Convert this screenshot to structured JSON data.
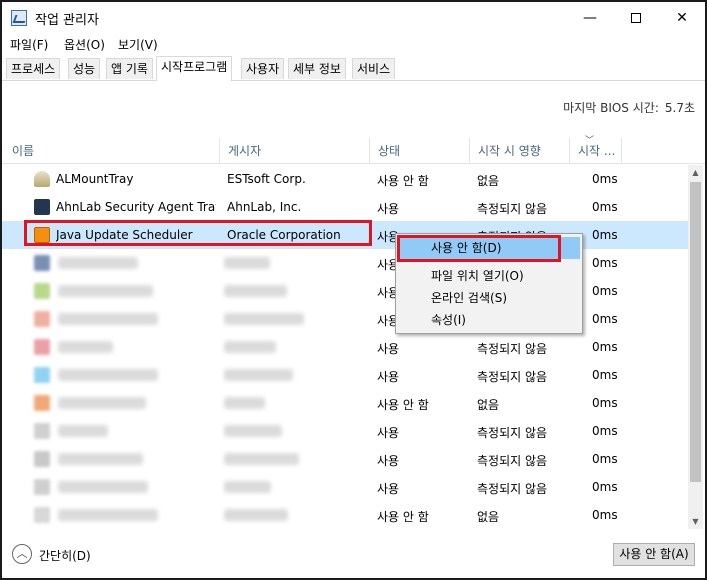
{
  "window": {
    "title": "작업 관리자",
    "minimize": "—",
    "close": "✕"
  },
  "menu": [
    {
      "label": "파일(F)"
    },
    {
      "label": "옵션(O)"
    },
    {
      "label": "보기(V)"
    }
  ],
  "tabs": [
    {
      "label": "프로세스"
    },
    {
      "label": "성능"
    },
    {
      "label": "앱 기록"
    },
    {
      "label": "시작프로그램",
      "active": true
    },
    {
      "label": "사용자"
    },
    {
      "label": "세부 정보"
    },
    {
      "label": "서비스"
    }
  ],
  "bios": {
    "label": "마지막 BIOS 시간:",
    "value": "5.7초"
  },
  "columns": {
    "name": "이름",
    "publisher": "게시자",
    "status": "상태",
    "impact": "시작 시 영향",
    "cpu": "시작 ..."
  },
  "rows": [
    {
      "name": "ALMountTray",
      "publisher": "ESTsoft Corp.",
      "status": "사용 안 함",
      "impact": "없음",
      "time": "0ms",
      "icon": "almount-icon"
    },
    {
      "name": "AhnLab Security Agent Tray...",
      "publisher": "AhnLab, Inc.",
      "status": "사용",
      "impact": "측정되지 않음",
      "time": "0ms",
      "icon": "ahnlab-icon"
    },
    {
      "name": "Java Update Scheduler",
      "publisher": "Oracle Corporation",
      "status": "사용",
      "impact": "측정되지 않음",
      "time": "0ms",
      "icon": "java-icon",
      "selected": true
    },
    {
      "name": "",
      "publisher": "",
      "status": "사용",
      "impact": "",
      "time": "0ms",
      "icon": "blurred-icon"
    },
    {
      "name": "",
      "publisher": "",
      "status": "사용",
      "impact": "",
      "time": "0ms",
      "icon": "blurred-icon"
    },
    {
      "name": "",
      "publisher": "",
      "status": "사용",
      "impact": "",
      "time": "0ms",
      "icon": "blurred-icon"
    },
    {
      "name": "",
      "publisher": "",
      "status": "사용",
      "impact": "측정되지 않음",
      "time": "0ms",
      "icon": "blurred-icon"
    },
    {
      "name": "",
      "publisher": "",
      "status": "사용",
      "impact": "측정되지 않음",
      "time": "0ms",
      "icon": "blurred-icon"
    },
    {
      "name": "",
      "publisher": "",
      "status": "사용 안 함",
      "impact": "없음",
      "time": "0ms",
      "icon": "blurred-icon"
    },
    {
      "name": "",
      "publisher": "",
      "status": "사용",
      "impact": "측정되지 않음",
      "time": "0ms",
      "icon": "blurred-icon"
    },
    {
      "name": "",
      "publisher": "",
      "status": "사용",
      "impact": "측정되지 않음",
      "time": "0ms",
      "icon": "blurred-icon"
    },
    {
      "name": "",
      "publisher": "",
      "status": "사용",
      "impact": "측정되지 않음",
      "time": "0ms",
      "icon": "blurred-icon"
    },
    {
      "name": "",
      "publisher": "",
      "status": "사용 안 함",
      "impact": "없음",
      "time": "0ms",
      "icon": "blurred-icon"
    }
  ],
  "context_menu": [
    {
      "label": "사용 안 함(D)",
      "highlighted": true
    },
    {
      "label": "파일 위치 열기(O)"
    },
    {
      "label": "온라인 검색(S)"
    },
    {
      "label": "속성(I)"
    }
  ],
  "footer": {
    "collapse": "간단히(D)",
    "disable_button": "사용 안 함(A)"
  },
  "colors": {
    "selected_row": "#cce8ff",
    "highlight_box": "#e0151f",
    "menu_hover": "#91c9f7",
    "header_text": "#4c6782"
  }
}
